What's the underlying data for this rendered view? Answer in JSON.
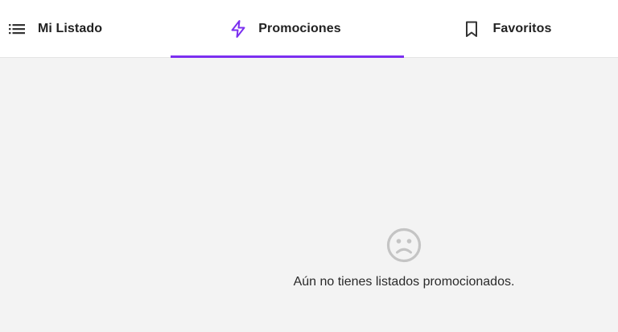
{
  "tabs": [
    {
      "label": "Mi Listado",
      "icon": "list-icon",
      "selected": false
    },
    {
      "label": "Promociones",
      "icon": "lightning-icon",
      "selected": true
    },
    {
      "label": "Favoritos",
      "icon": "bookmark-icon",
      "selected": false
    }
  ],
  "empty_state": {
    "icon": "sad-face-icon",
    "message": "Aún no tienes listados promocionados."
  },
  "colors": {
    "accent": "#7b2ff0",
    "background": "#f3f3f3",
    "tabbar": "#ffffff",
    "muted_icon": "#c4c4c4"
  }
}
